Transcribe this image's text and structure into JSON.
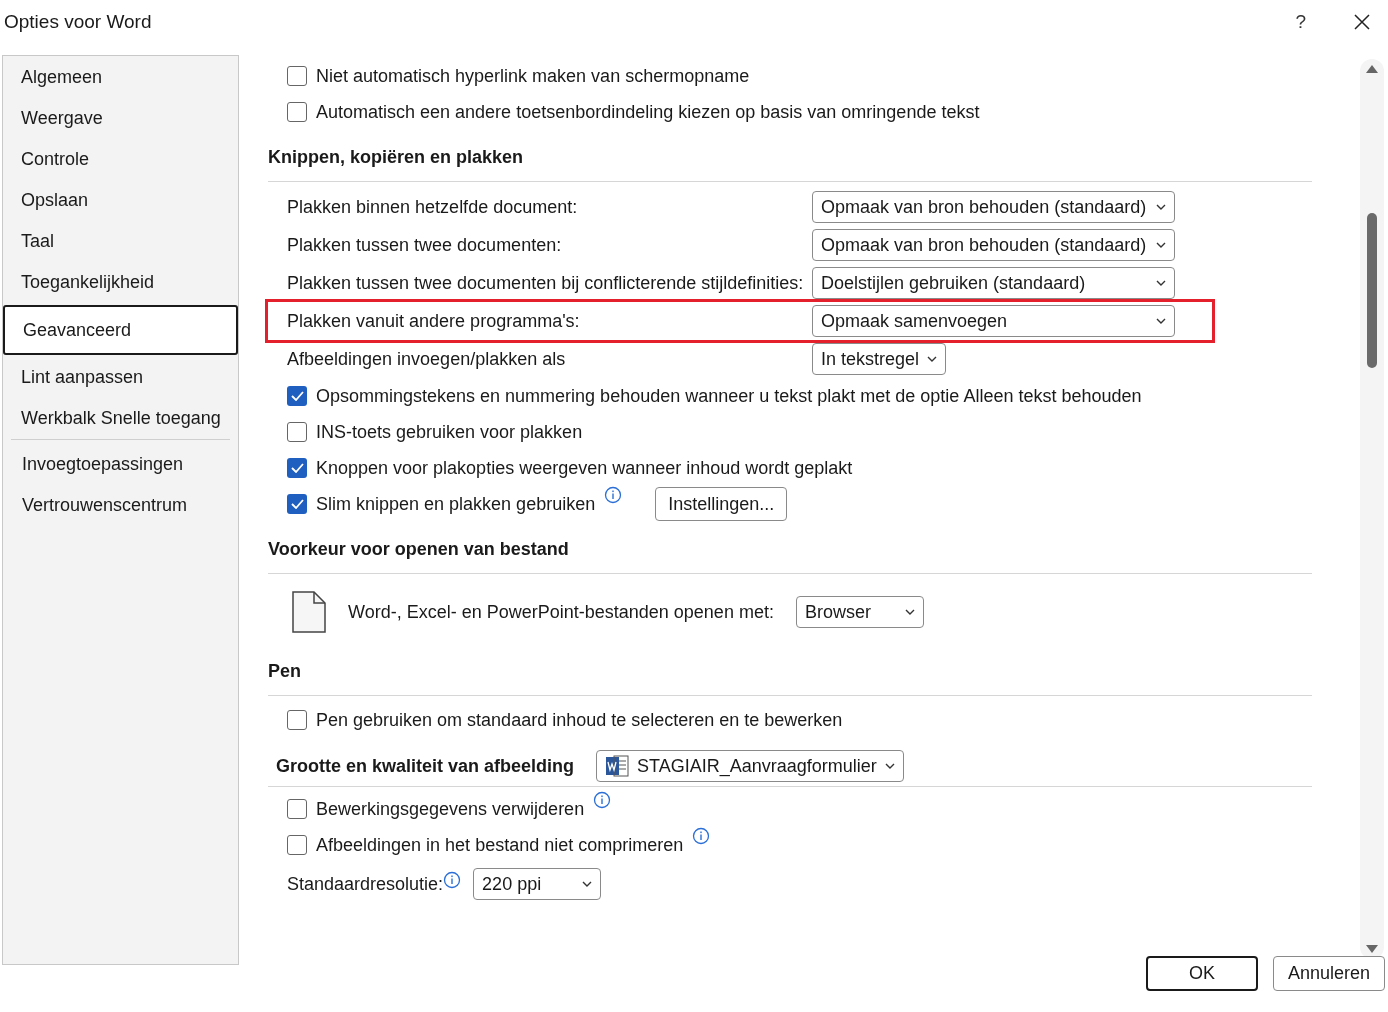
{
  "window": {
    "title": "Opties voor Word",
    "help": "?"
  },
  "sidebar": {
    "groups": [
      [
        {
          "label": "Algemeen",
          "selected": false
        },
        {
          "label": "Weergave",
          "selected": false
        },
        {
          "label": "Controle",
          "selected": false
        },
        {
          "label": "Opslaan",
          "selected": false
        },
        {
          "label": "Taal",
          "selected": false
        },
        {
          "label": "Toegankelijkheid",
          "selected": false
        },
        {
          "label": "Geavanceerd",
          "selected": true
        },
        {
          "label": "Lint aanpassen",
          "selected": false
        },
        {
          "label": "Werkbalk Snelle toegang",
          "selected": false
        }
      ],
      [
        {
          "label": "Invoegtoepassingen",
          "selected": false
        },
        {
          "label": "Vertrouwenscentrum",
          "selected": false
        }
      ]
    ]
  },
  "content": [
    {
      "kind": "checkbox",
      "label": "Niet automatisch hyperlink maken van schermopname",
      "checked": false
    },
    {
      "kind": "checkbox",
      "label": "Automatisch een andere toetsenbordindeling kiezen op basis van omringende tekst",
      "checked": false
    },
    {
      "kind": "heading",
      "label": "Knippen, kopiëren en plakken"
    },
    {
      "kind": "select",
      "label": "Plakken binnen hetzelfde document:",
      "value": "Opmaak van bron behouden (standaard)",
      "highlighted": false
    },
    {
      "kind": "select",
      "label": "Plakken tussen twee documenten:",
      "value": "Opmaak van bron behouden (standaard)",
      "highlighted": false
    },
    {
      "kind": "select",
      "label": "Plakken tussen twee documenten bij conflicterende stijldefinities:",
      "value": "Doelstijlen gebruiken (standaard)",
      "highlighted": false
    },
    {
      "kind": "select",
      "label": "Plakken vanuit andere programma's:",
      "value": "Opmaak samenvoegen",
      "highlighted": true
    },
    {
      "kind": "select",
      "label": "Afbeeldingen invoegen/plakken als",
      "value": "In tekstregel",
      "highlighted": false
    },
    {
      "kind": "checkbox",
      "label": "Opsommingstekens en nummering behouden wanneer u tekst plakt met de optie Alleen tekst behouden",
      "checked": true
    },
    {
      "kind": "checkbox",
      "label": "INS-toets gebruiken voor plakken",
      "checked": false
    },
    {
      "kind": "checkbox",
      "label": "Knoppen voor plakopties weergeven wanneer inhoud wordt geplakt",
      "checked": true
    },
    {
      "kind": "checkbox",
      "label": "Slim knippen en plakken gebruiken",
      "checked": true,
      "info": true,
      "button": "Instellingen..."
    },
    {
      "kind": "heading",
      "label": "Voorkeur voor openen van bestand"
    },
    {
      "kind": "file",
      "label": "Word-, Excel- en PowerPoint-bestanden openen met:",
      "value": "Browser"
    },
    {
      "kind": "heading",
      "label": "Pen"
    },
    {
      "kind": "checkbox",
      "label": "Pen gebruiken om standaard inhoud te selecteren en te bewerken",
      "checked": false
    },
    {
      "kind": "docheading",
      "label": "Grootte en kwaliteit van afbeelding",
      "value": "STAGIAIR_Aanvraagformulier"
    },
    {
      "kind": "checkbox",
      "label": "Bewerkingsgegevens verwijderen",
      "checked": false,
      "info": true
    },
    {
      "kind": "checkbox",
      "label": "Afbeeldingen in het bestand niet comprimeren",
      "checked": false,
      "info": true
    },
    {
      "kind": "resolution",
      "label": "Standaardresolutie:",
      "value": "220 ppi",
      "info": true
    }
  ],
  "buttons": [
    "OK",
    "Annuleren"
  ]
}
